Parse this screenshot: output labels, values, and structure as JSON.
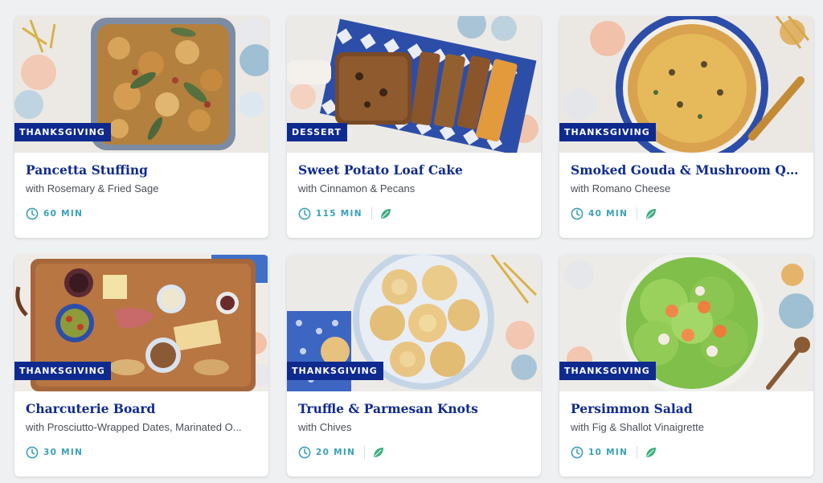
{
  "cards": [
    {
      "tag": "THANKSGIVING",
      "title": "Pancetta Stuffing",
      "subtitle": "with Rosemary & Fried Sage",
      "time": "60 MIN",
      "leaf_icon": false,
      "image": "pancetta-stuffing-photo"
    },
    {
      "tag": "DESSERT",
      "title": "Sweet Potato Loaf Cake",
      "subtitle": "with Cinnamon & Pecans",
      "time": "115 MIN",
      "leaf_icon": true,
      "image": "sweet-potato-loaf-photo"
    },
    {
      "tag": "THANKSGIVING",
      "title": "Smoked Gouda & Mushroom Quiche",
      "subtitle": "with Romano Cheese",
      "time": "40 MIN",
      "leaf_icon": true,
      "image": "quiche-photo"
    },
    {
      "tag": "THANKSGIVING",
      "title": "Charcuterie Board",
      "subtitle": "with Prosciutto-Wrapped Dates, Marinated O...",
      "time": "30 MIN",
      "leaf_icon": false,
      "image": "charcuterie-board-photo"
    },
    {
      "tag": "THANKSGIVING",
      "title": "Truffle & Parmesan Knots",
      "subtitle": "with Chives",
      "time": "20 MIN",
      "leaf_icon": true,
      "image": "garlic-knots-photo"
    },
    {
      "tag": "THANKSGIVING",
      "title": "Persimmon Salad",
      "subtitle": "with Fig & Shallot Vinaigrette",
      "time": "10 MIN",
      "leaf_icon": true,
      "image": "persimmon-salad-photo"
    }
  ],
  "colors": {
    "tag_background": "#0f2a8f",
    "title": "#0f2a8f",
    "time": "#3aa0b8",
    "leaf": "#3fae7f"
  }
}
